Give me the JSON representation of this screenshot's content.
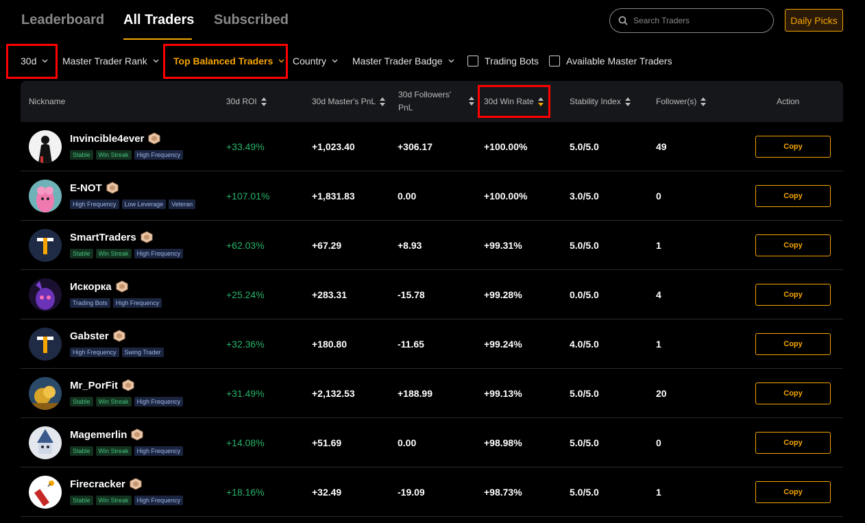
{
  "nav": {
    "tabs": [
      {
        "label": "Leaderboard"
      },
      {
        "label": "All Traders"
      },
      {
        "label": "Subscribed"
      }
    ],
    "search_placeholder": "Search Traders",
    "daily_picks": "Daily Picks"
  },
  "filters": {
    "period": "30d",
    "rank": "Master Trader Rank",
    "balanced": "Top Balanced Traders",
    "country": "Country",
    "badge": "Master Trader Badge",
    "bots": "Trading Bots",
    "available": "Available Master Traders"
  },
  "columns": {
    "nickname": "Nickname",
    "roi": "30d ROI",
    "master_pnl": "30d Master's PnL",
    "followers_pnl_1": "30d Followers'",
    "followers_pnl_2": "PnL",
    "win_rate": "30d Win Rate",
    "stability": "Stability Index",
    "followers": "Follower(s)",
    "action": "Action"
  },
  "accent_color": "#f7a600",
  "rows": [
    {
      "name": "Invincible4ever",
      "tags": [
        "Stable",
        "Win Streak",
        "High Frequency"
      ],
      "roi": "+33.49%",
      "master_pnl": "+1,023.40",
      "followers_pnl": "+306.17",
      "win_rate": "+100.00%",
      "stability": "5.0/5.0",
      "followers": "49",
      "action": "Copy",
      "avatar": "silhouette"
    },
    {
      "name": "E-NOT",
      "tags": [
        "High Frequency",
        "Low Leverage",
        "Veteran"
      ],
      "roi": "+107.01%",
      "master_pnl": "+1,831.83",
      "followers_pnl": "0.00",
      "win_rate": "+100.00%",
      "stability": "3.0/5.0",
      "followers": "0",
      "action": "Copy",
      "avatar": "pink-llama"
    },
    {
      "name": "SmartTraders",
      "tags": [
        "Stable",
        "Win Streak",
        "High Frequency"
      ],
      "roi": "+62.03%",
      "master_pnl": "+67.29",
      "followers_pnl": "+8.93",
      "win_rate": "+99.31%",
      "stability": "5.0/5.0",
      "followers": "1",
      "action": "Copy",
      "avatar": "T"
    },
    {
      "name": "Искорка",
      "tags": [
        "Trading Bots",
        "High Frequency"
      ],
      "roi": "+25.24%",
      "master_pnl": "+283.31",
      "followers_pnl": "-15.78",
      "win_rate": "+99.28%",
      "stability": "0.0/5.0",
      "followers": "4",
      "action": "Copy",
      "avatar": "purple-pony"
    },
    {
      "name": "Gabster",
      "tags": [
        "High Frequency",
        "Swing Trader"
      ],
      "roi": "+32.36%",
      "master_pnl": "+180.80",
      "followers_pnl": "-11.65",
      "win_rate": "+99.24%",
      "stability": "4.0/5.0",
      "followers": "1",
      "action": "Copy",
      "avatar": "T"
    },
    {
      "name": "Mr_PorFit",
      "tags": [
        "Stable",
        "Win Streak",
        "High Frequency"
      ],
      "roi": "+31.49%",
      "master_pnl": "+2,132.53",
      "followers_pnl": "+188.99",
      "win_rate": "+99.13%",
      "stability": "5.0/5.0",
      "followers": "20",
      "action": "Copy",
      "avatar": "gold-coins"
    },
    {
      "name": "Magemerlin",
      "tags": [
        "Stable",
        "Win Streak",
        "High Frequency"
      ],
      "roi": "+14.08%",
      "master_pnl": "+51.69",
      "followers_pnl": "0.00",
      "win_rate": "+98.98%",
      "stability": "5.0/5.0",
      "followers": "0",
      "action": "Copy",
      "avatar": "wizard"
    },
    {
      "name": "Firecracker",
      "tags": [
        "Stable",
        "Win Streak",
        "High Frequency"
      ],
      "roi": "+18.16%",
      "master_pnl": "+32.49",
      "followers_pnl": "-19.09",
      "win_rate": "+98.73%",
      "stability": "5.0/5.0",
      "followers": "1",
      "action": "Copy",
      "avatar": "firecracker"
    }
  ]
}
